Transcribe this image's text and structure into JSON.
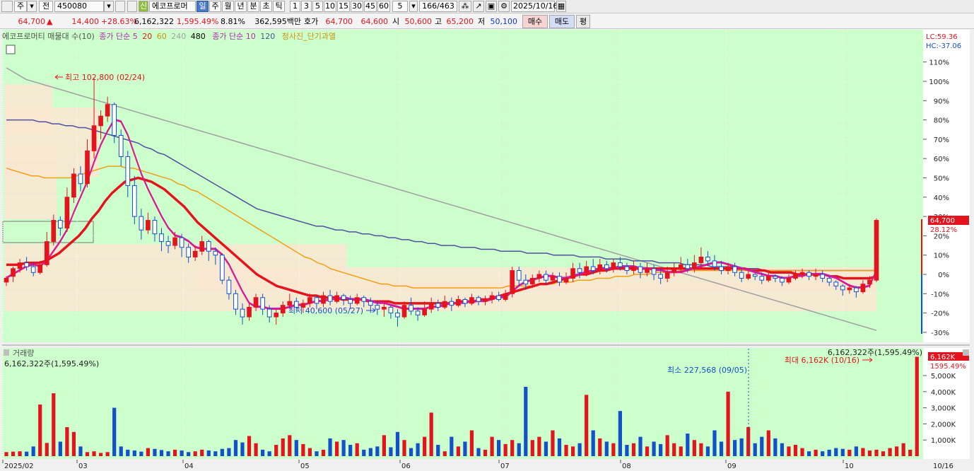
{
  "toolbar": {
    "market": "주",
    "tab_current": "전",
    "code": "450080",
    "new_badge": "신",
    "stock_name": "에코프로머",
    "periods": [
      "일",
      "주",
      "월",
      "년",
      "분",
      "초",
      "틱"
    ],
    "intervals": [
      "1",
      "3",
      "5",
      "10",
      "15",
      "30",
      "45",
      "60"
    ],
    "interval_value": "5",
    "range": "166/463",
    "date": "2025/10/16"
  },
  "quote": {
    "price": "64,700",
    "arrow": "▲",
    "change": "14,400",
    "change_pct": "+28.63%",
    "volume": "6,162,322",
    "volume_pct": "1,595.49%",
    "turnover_pct": "8.81%",
    "amount": "362,595백만",
    "hoga_label": "호가",
    "ask": "64,700",
    "bid": "64,600",
    "open_label": "시",
    "open": "50,600",
    "high_label": "고",
    "high": "65,200",
    "low_label": "저",
    "low": "50,100",
    "buy_label": "매수",
    "sell_label": "매도",
    "eval_label": "평"
  },
  "legend": {
    "indicator": "에코프로머티 매물대 수(10)",
    "ma_label": "종가 단순 5",
    "ma_20": "20",
    "ma_60": "60",
    "ma_240": "240",
    "ma_480": "480",
    "ma2_label": "종가 단순 10",
    "ma_120": "120",
    "signal": "청사진_단기과열"
  },
  "colors": {
    "chart_bg": "#ccffcc",
    "up": "#e4141e",
    "down": "#1450c8",
    "ma5": "#e4148c",
    "ma10": "#b428b4",
    "ma20": "#e4141e",
    "ma60": "#f0a014",
    "ma120": "#5050a0",
    "ma240": "#a0a0a0",
    "volume_profile": "#fae6d2"
  },
  "price_scale": {
    "lc": "LC:59.36",
    "hc": "HC:-37.06",
    "ticks": [
      "110%",
      "100%",
      "90%",
      "80%",
      "70%",
      "60%",
      "50%",
      "40%",
      "30%",
      "20%",
      "10%",
      "0%",
      "-10%",
      "-20%",
      "-30%"
    ],
    "current_price": "64,700",
    "current_pct": "28.12%"
  },
  "annotations": {
    "high": "최고 102,800 (02/24)",
    "low": "최저 40,600 (05/27)",
    "vol_min": "최소 227,568 (09/05)",
    "vol_max": "최대 6,162K (10/16)"
  },
  "volume_panel": {
    "title": "거래량",
    "value": "6,162,322주(1,595.49%)",
    "top_right": "6,162,322주(1,595.49%)",
    "ticks": [
      "5,000K",
      "4,000K",
      "3,000K",
      "2,000K",
      "1,000K"
    ],
    "current": "6,162K",
    "current_pct": "1595.49%"
  },
  "x_axis": {
    "labels": [
      "2025/02",
      "03",
      "04",
      "05",
      "06",
      "07",
      "08",
      "09",
      "10"
    ],
    "right_label": "10/16"
  },
  "chart_data": {
    "type": "candlestick",
    "title": "에코프로머티",
    "y_axis": "percent from base close (50,300)",
    "ylim": [
      -33,
      113
    ],
    "ohlc_pct": [
      [
        -4,
        -2,
        -6,
        -1
      ],
      [
        -1,
        3,
        -4,
        4
      ],
      [
        3,
        6,
        1,
        8
      ],
      [
        6,
        4,
        2,
        9
      ],
      [
        4,
        1,
        -1,
        6
      ],
      [
        1,
        5,
        0,
        7
      ],
      [
        5,
        17,
        4,
        22
      ],
      [
        17,
        28,
        15,
        31
      ],
      [
        28,
        24,
        20,
        30
      ],
      [
        24,
        40,
        22,
        45
      ],
      [
        40,
        52,
        37,
        55
      ],
      [
        52,
        47,
        43,
        56
      ],
      [
        47,
        64,
        45,
        70
      ],
      [
        64,
        77,
        60,
        102
      ],
      [
        77,
        82,
        70,
        85
      ],
      [
        82,
        88,
        79,
        92
      ],
      [
        88,
        72,
        68,
        89
      ],
      [
        72,
        61,
        56,
        75
      ],
      [
        61,
        46,
        40,
        64
      ],
      [
        46,
        30,
        26,
        51
      ],
      [
        30,
        23,
        18,
        34
      ],
      [
        23,
        28,
        21,
        32
      ],
      [
        28,
        21,
        17,
        30
      ],
      [
        21,
        17,
        12,
        24
      ],
      [
        17,
        15,
        11,
        20
      ],
      [
        15,
        19,
        13,
        22
      ],
      [
        19,
        14,
        9,
        21
      ],
      [
        14,
        9,
        6,
        16
      ],
      [
        9,
        12,
        7,
        15
      ],
      [
        12,
        17,
        10,
        20
      ],
      [
        17,
        12,
        7,
        18
      ],
      [
        12,
        10,
        5,
        14
      ],
      [
        10,
        -3,
        -5,
        11
      ],
      [
        -3,
        -10,
        -13,
        -1
      ],
      [
        -10,
        -18,
        -21,
        -8
      ],
      [
        -18,
        -22,
        -26,
        -15
      ],
      [
        -22,
        -17,
        -24,
        -15
      ],
      [
        -17,
        -12,
        -19,
        -10
      ],
      [
        -12,
        -18,
        -21,
        -10
      ],
      [
        -18,
        -22,
        -25,
        -16
      ],
      [
        -22,
        -20,
        -26,
        -18
      ],
      [
        -20,
        -16,
        -22,
        -14
      ],
      [
        -16,
        -14,
        -18,
        -10
      ],
      [
        -14,
        -17,
        -19,
        -12
      ],
      [
        -17,
        -15,
        -20,
        -13
      ],
      [
        -15,
        -12,
        -17,
        -10
      ],
      [
        -12,
        -15,
        -18,
        -11
      ],
      [
        -15,
        -11,
        -17,
        -9
      ],
      [
        -11,
        -14,
        -16,
        -8
      ],
      [
        -14,
        -11,
        -15,
        -9
      ],
      [
        -11,
        -13,
        -16,
        -10
      ],
      [
        -13,
        -15,
        -18,
        -11
      ],
      [
        -15,
        -12,
        -16,
        -10
      ],
      [
        -12,
        -14,
        -17,
        -11
      ],
      [
        -14,
        -16,
        -20,
        -12
      ],
      [
        -16,
        -18,
        -21,
        -14
      ],
      [
        -18,
        -17,
        -22,
        -15
      ],
      [
        -17,
        -20,
        -23,
        -16
      ],
      [
        -20,
        -22,
        -27,
        -18
      ],
      [
        -22,
        -16,
        -23,
        -14
      ],
      [
        -16,
        -19,
        -21,
        -12
      ],
      [
        -19,
        -21,
        -24,
        -17
      ],
      [
        -21,
        -18,
        -22,
        -14
      ],
      [
        -18,
        -15,
        -20,
        -12
      ],
      [
        -15,
        -17,
        -19,
        -13
      ],
      [
        -17,
        -14,
        -18,
        -11
      ],
      [
        -14,
        -16,
        -19,
        -12
      ],
      [
        -16,
        -13,
        -17,
        -11
      ],
      [
        -13,
        -15,
        -17,
        -12
      ],
      [
        -15,
        -12,
        -16,
        -10
      ],
      [
        -12,
        -14,
        -16,
        -11
      ],
      [
        -14,
        -13,
        -16,
        -11
      ],
      [
        -13,
        -11,
        -15,
        -9
      ],
      [
        -11,
        -13,
        -14,
        -9
      ],
      [
        -13,
        -10,
        -14,
        -8
      ],
      [
        -10,
        2,
        -12,
        4
      ],
      [
        2,
        -3,
        -6,
        4
      ],
      [
        -3,
        -5,
        -8,
        0
      ],
      [
        -5,
        -2,
        -7,
        0
      ],
      [
        -2,
        0,
        -4,
        2
      ],
      [
        0,
        -3,
        -5,
        2
      ],
      [
        -3,
        -1,
        -5,
        1
      ],
      [
        -1,
        -4,
        -6,
        1
      ],
      [
        -4,
        -2,
        -5,
        1
      ],
      [
        -2,
        3,
        -4,
        6
      ],
      [
        3,
        1,
        -2,
        6
      ],
      [
        1,
        4,
        -1,
        7
      ],
      [
        4,
        2,
        0,
        8
      ],
      [
        2,
        5,
        0,
        8
      ],
      [
        5,
        3,
        1,
        7
      ],
      [
        3,
        6,
        1,
        8
      ],
      [
        6,
        4,
        2,
        9
      ],
      [
        4,
        2,
        0,
        6
      ],
      [
        2,
        4,
        0,
        7
      ],
      [
        4,
        1,
        -2,
        6
      ],
      [
        1,
        3,
        -1,
        6
      ],
      [
        3,
        0,
        -3,
        5
      ],
      [
        0,
        -2,
        -5,
        3
      ],
      [
        -2,
        1,
        -4,
        4
      ],
      [
        1,
        3,
        -1,
        6
      ],
      [
        3,
        5,
        1,
        9
      ],
      [
        5,
        3,
        1,
        8
      ],
      [
        3,
        6,
        1,
        10
      ],
      [
        6,
        9,
        4,
        14
      ],
      [
        9,
        7,
        5,
        12
      ],
      [
        7,
        4,
        2,
        10
      ],
      [
        4,
        2,
        0,
        7
      ],
      [
        2,
        4,
        0,
        6
      ],
      [
        4,
        1,
        -1,
        6
      ],
      [
        1,
        -2,
        -4,
        3
      ],
      [
        -2,
        0,
        -3,
        2
      ],
      [
        0,
        -1,
        -3,
        1
      ],
      [
        -1,
        -3,
        -5,
        1
      ],
      [
        -3,
        -1,
        -4,
        1
      ],
      [
        -1,
        -2,
        -4,
        0
      ],
      [
        -2,
        -4,
        -6,
        -1
      ],
      [
        -4,
        -2,
        -5,
        0
      ],
      [
        -2,
        0,
        -3,
        2
      ],
      [
        0,
        1,
        -2,
        3
      ],
      [
        1,
        -1,
        -3,
        2
      ],
      [
        -1,
        0,
        -3,
        3
      ],
      [
        0,
        -2,
        -4,
        2
      ],
      [
        -2,
        -4,
        -6,
        -1
      ],
      [
        -4,
        -6,
        -8,
        -3
      ],
      [
        -6,
        -8,
        -11,
        -5
      ],
      [
        -8,
        -7,
        -10,
        -5
      ],
      [
        -7,
        -9,
        -12,
        -6
      ],
      [
        -9,
        -5,
        -10,
        -3
      ],
      [
        -5,
        -3,
        -7,
        -1
      ],
      [
        -3,
        28,
        -4,
        29
      ]
    ],
    "ma5_pct": [
      -2,
      0,
      2,
      4,
      5,
      4,
      7,
      12,
      17,
      23,
      32,
      40,
      48,
      58,
      67,
      74,
      80,
      79,
      72,
      62,
      52,
      44,
      37,
      30,
      24,
      20,
      19,
      17,
      14,
      13,
      13,
      13,
      10,
      5,
      -2,
      -9,
      -15,
      -17,
      -17,
      -18,
      -18,
      -18,
      -17,
      -16,
      -16,
      -15,
      -14,
      -14,
      -13,
      -13,
      -12,
      -13,
      -13,
      -13,
      -14,
      -15,
      -15,
      -16,
      -17,
      -18,
      -18,
      -18,
      -18,
      -17,
      -17,
      -16,
      -15,
      -15,
      -15,
      -14,
      -14,
      -14,
      -13,
      -12,
      -12,
      -9,
      -6,
      -4,
      -3,
      -2,
      -1,
      -1,
      -2,
      -2,
      -1,
      0,
      1,
      2,
      3,
      3,
      3,
      4,
      4,
      4,
      3,
      3,
      2,
      2,
      1,
      1,
      1,
      2,
      3,
      4,
      5,
      6,
      6,
      5,
      4,
      3,
      2,
      1,
      0,
      -1,
      -1,
      -2,
      -2,
      -1,
      -1,
      0,
      0,
      0,
      -1,
      -2,
      -4,
      -6,
      -7,
      -7,
      -6,
      2
    ],
    "ma20_pct": [
      5,
      5,
      5,
      6,
      6,
      6,
      7,
      9,
      11,
      14,
      17,
      20,
      24,
      29,
      33,
      38,
      42,
      45,
      48,
      49,
      50,
      49,
      48,
      46,
      44,
      41,
      38,
      35,
      31,
      27,
      24,
      21,
      18,
      15,
      12,
      9,
      6,
      3,
      0,
      -2,
      -4,
      -6,
      -7,
      -8,
      -9,
      -10,
      -11,
      -11,
      -12,
      -12,
      -12,
      -13,
      -13,
      -13,
      -13,
      -14,
      -14,
      -14,
      -14,
      -15,
      -15,
      -15,
      -15,
      -15,
      -15,
      -15,
      -15,
      -15,
      -15,
      -14,
      -14,
      -14,
      -13,
      -13,
      -12,
      -11,
      -10,
      -9,
      -8,
      -7,
      -6,
      -5,
      -5,
      -4,
      -3,
      -2,
      -1,
      0,
      0,
      1,
      2,
      2,
      3,
      3,
      3,
      3,
      3,
      3,
      3,
      3,
      3,
      3,
      3,
      3,
      3,
      3,
      3,
      3,
      3,
      3,
      3,
      3,
      3,
      2,
      2,
      2,
      1,
      1,
      1,
      1,
      0,
      0,
      0,
      0,
      0,
      -1,
      -1,
      -2,
      -2,
      -2,
      -2,
      -2,
      -1
    ],
    "ma60_pct": [
      55,
      54,
      53,
      52,
      51,
      51,
      50,
      50,
      50,
      50,
      50,
      51,
      52,
      53,
      54,
      55,
      56,
      56,
      56,
      55,
      55,
      54,
      53,
      52,
      51,
      50,
      49,
      47,
      46,
      44,
      43,
      41,
      39,
      37,
      35,
      33,
      31,
      29,
      27,
      25,
      23,
      21,
      19,
      17,
      15,
      13,
      11,
      9,
      8,
      6,
      5,
      3,
      2,
      1,
      0,
      -1,
      -2,
      -3,
      -4,
      -5,
      -5,
      -6,
      -6,
      -6,
      -7,
      -7,
      -7,
      -7,
      -7,
      -7,
      -7,
      -7,
      -7,
      -7,
      -7,
      -7,
      -7,
      -7,
      -7,
      -6,
      -6,
      -6,
      -6,
      -6,
      -5,
      -5,
      -5,
      -4,
      -4,
      -4,
      -3,
      -3,
      -3,
      -2,
      -2,
      -2,
      -1,
      -1,
      -1,
      0,
      0,
      0,
      1,
      1,
      1,
      1,
      2,
      2,
      2,
      2,
      2,
      2,
      2,
      2,
      2,
      2,
      2,
      2,
      2,
      2,
      2,
      2,
      2,
      2,
      2,
      2,
      2,
      2,
      2,
      2,
      2,
      2,
      2,
      2,
      2,
      2,
      2,
      2
    ],
    "ma120_pct": [
      80,
      80,
      80,
      80,
      80,
      79,
      79,
      78,
      78,
      77,
      77,
      76,
      76,
      75,
      74,
      73,
      72,
      71,
      70,
      69,
      68,
      66,
      65,
      63,
      62,
      60,
      58,
      56,
      54,
      52,
      50,
      48,
      46,
      44,
      42,
      40,
      38,
      36,
      34,
      33,
      32,
      31,
      30,
      29,
      28,
      27,
      26,
      25,
      25,
      24,
      23,
      23,
      22,
      22,
      21,
      21,
      20,
      20,
      19,
      19,
      18,
      18,
      17,
      17,
      16,
      16,
      15,
      15,
      15,
      14,
      14,
      14,
      13,
      13,
      13,
      12,
      12,
      12,
      12,
      11,
      11,
      11,
      11,
      10,
      10,
      10,
      10,
      9,
      9,
      9,
      9,
      8,
      8,
      8,
      8,
      7,
      7,
      7,
      7,
      6,
      6,
      6,
      6,
      5,
      5,
      5,
      5,
      4,
      4,
      4,
      4,
      3,
      3,
      3,
      3,
      2,
      2,
      2,
      2,
      2,
      2,
      2,
      2,
      2,
      2,
      2,
      2,
      2,
      2,
      2,
      2,
      2,
      2
    ],
    "ma240_pct": [
      107,
      105,
      103,
      101,
      100,
      99,
      98,
      97,
      96,
      95,
      94,
      93,
      92,
      91,
      90,
      89,
      88,
      87,
      86,
      85,
      84,
      83,
      82,
      81,
      80,
      79,
      78,
      77,
      76,
      75,
      74,
      73,
      72,
      71,
      70,
      69,
      68,
      67,
      66,
      65,
      64,
      63,
      62,
      61,
      60,
      59,
      58,
      57,
      56,
      55,
      54,
      53,
      52,
      51,
      50,
      49,
      48,
      47,
      46,
      45,
      44,
      43,
      42,
      41,
      40,
      39,
      38,
      37,
      36,
      35,
      34,
      33,
      32,
      31,
      30,
      29,
      28,
      27,
      26,
      25,
      24,
      23,
      22,
      21,
      20,
      19,
      18,
      17,
      16,
      15,
      14,
      13,
      12,
      11,
      10,
      9,
      8,
      7,
      6,
      5,
      4,
      3,
      2,
      1,
      0,
      -1,
      -2,
      -3,
      -4,
      -5,
      -6,
      -7,
      -8,
      -9,
      -10,
      -11,
      -12,
      -13,
      -14,
      -15,
      -16,
      -17,
      -18,
      -19,
      -20,
      -21,
      -22,
      -23,
      -24,
      -25,
      -26,
      -27,
      -28,
      -29
    ],
    "volume_k": [
      250,
      280,
      300,
      280,
      600,
      3200,
      820,
      3900,
      900,
      1800,
      1500,
      600,
      250,
      300,
      200,
      250,
      3000,
      600,
      400,
      350,
      280,
      500,
      450,
      380,
      300,
      400,
      350,
      250,
      300,
      400,
      350,
      300,
      450,
      500,
      1000,
      850,
      1250,
      800,
      400,
      300,
      700,
      1100,
      1300,
      1000,
      750,
      500,
      300,
      400,
      1100,
      900,
      1000,
      700,
      800,
      400,
      500,
      600,
      1300,
      550,
      1500,
      1000,
      500,
      800,
      1200,
      2700,
      700,
      300,
      1200,
      600,
      900,
      1600,
      500,
      400,
      1200,
      1000,
      750,
      1000,
      800,
      4300,
      1000,
      1200,
      900,
      1600,
      1100,
      700,
      600,
      800,
      3800,
      1600,
      1100,
      900,
      800,
      2800,
      700,
      800,
      1200,
      600,
      900,
      750,
      1300,
      800,
      600,
      1400,
      1000,
      800,
      600,
      1600,
      900,
      4000,
      1000,
      1100,
      1800,
      800,
      1200,
      1600,
      1100,
      800,
      600,
      700,
      500,
      300,
      400,
      300,
      400,
      500,
      450,
      400,
      600,
      500,
      350,
      400,
      300,
      500,
      600,
      800,
      400,
      6162
    ]
  }
}
